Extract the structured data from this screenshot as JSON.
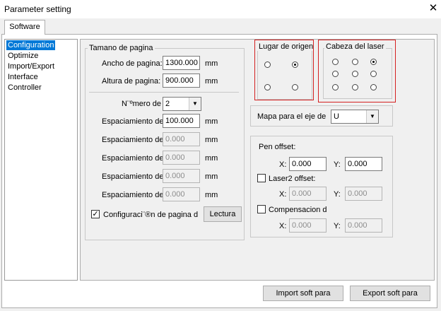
{
  "window": {
    "title": "Parameter setting",
    "close_glyph": "✕"
  },
  "tabs": [
    {
      "label": "Software"
    }
  ],
  "sidebar": {
    "items": [
      {
        "label": "Configuration",
        "selected": true
      },
      {
        "label": "Optimize"
      },
      {
        "label": "Import/Export"
      },
      {
        "label": "Interface"
      },
      {
        "label": "Controller"
      }
    ]
  },
  "page_size": {
    "legend": "Tamano de pagina",
    "width_label": "Ancho de pagina:",
    "width_value": "1300.000",
    "height_label": "Altura de pagina:",
    "height_value": "900.000",
    "unit": "mm"
  },
  "pages": {
    "number_label": "N¨ºmero de",
    "number_value": "2",
    "spacing_label": "Espaciamiento de",
    "spacing_values": [
      "100.000",
      "0.000",
      "0.000",
      "0.000",
      "0.000"
    ],
    "unit": "mm",
    "config_label": "Configuraci¨®n de pagina d",
    "config_checked": true,
    "read_button": "Lectura"
  },
  "origin": {
    "legend": "Lugar de origen",
    "selected_index": 1
  },
  "laser_head": {
    "legend": "Cabeza del laser",
    "selected_index": 2
  },
  "axis_map": {
    "label": "Mapa para el eje de",
    "value": "U"
  },
  "offsets": {
    "pen_label": "Pen offset:",
    "pen_x": "0.000",
    "pen_y": "0.000",
    "laser2_label": "Laser2 offset:",
    "laser2_checked": false,
    "laser2_x": "0.000",
    "laser2_y": "0.000",
    "comp_label": "Compensacion d",
    "comp_checked": false,
    "comp_x": "0.000",
    "comp_y": "0.000",
    "x_label": "X:",
    "y_label": "Y:"
  },
  "footer": {
    "import_button": "Import soft para",
    "export_button": "Export soft para"
  },
  "icons": {
    "dropdown": "chevron-down-icon",
    "check": "checkmark-icon",
    "close": "close-icon"
  }
}
